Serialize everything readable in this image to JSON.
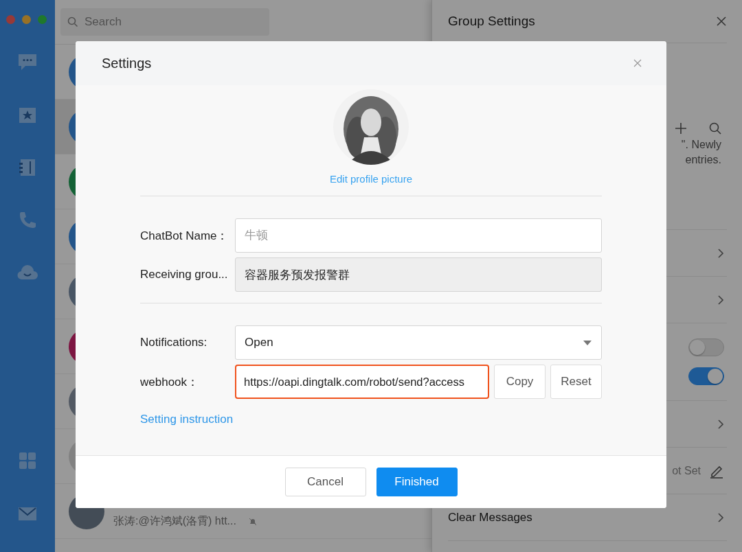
{
  "search": {
    "placeholder": "Search"
  },
  "chat_list": {
    "items": [
      {
        "color": "#23558a",
        "selected": false
      },
      {
        "color": "#23558a",
        "selected": true
      },
      {
        "color": "#146236",
        "selected": false
      },
      {
        "color": "#23558a",
        "selected": false
      },
      {
        "color": "#495665",
        "selected": false
      },
      {
        "color": "#7d1642",
        "selected": false
      },
      {
        "color": "#535a64",
        "selected": false
      },
      {
        "color": "#828282",
        "selected": false
      },
      {
        "color": "#434c56",
        "selected": false,
        "preview": "张涛:@许鸿斌(洛霄) htt..."
      }
    ]
  },
  "group_settings": {
    "title": "Group Settings",
    "notice": [
      "\". Newly",
      "entries."
    ],
    "rows": [
      {
        "kind": "link"
      },
      {
        "kind": "link"
      },
      {
        "kind": "toggles",
        "toggles": [
          {
            "on": false
          },
          {
            "on": true
          }
        ]
      },
      {
        "kind": "link"
      },
      {
        "kind": "value",
        "value": "ot Set"
      },
      {
        "kind": "link",
        "label": "Clear Messages"
      }
    ]
  },
  "dialog": {
    "title": "Settings",
    "edit_picture": "Edit profile picture",
    "fields": [
      {
        "kind": "input",
        "label": "ChatBot Name：",
        "placeholder": "牛顿",
        "disabled": false
      },
      {
        "kind": "input",
        "label": "Receiving grou...",
        "value": "容器服务预发报警群",
        "disabled": true
      },
      {
        "kind": "select",
        "label": "Notifications:",
        "value": "Open"
      },
      {
        "kind": "webhook",
        "label": "webhook：",
        "value": "https://oapi.dingtalk.com/robot/send?access",
        "highlighted": true,
        "buttons": [
          "Copy",
          "Reset"
        ]
      }
    ],
    "help_link": "Setting instruction",
    "buttons": [
      {
        "label": "Cancel",
        "kind": "default"
      },
      {
        "label": "Finished",
        "kind": "primary"
      }
    ]
  }
}
